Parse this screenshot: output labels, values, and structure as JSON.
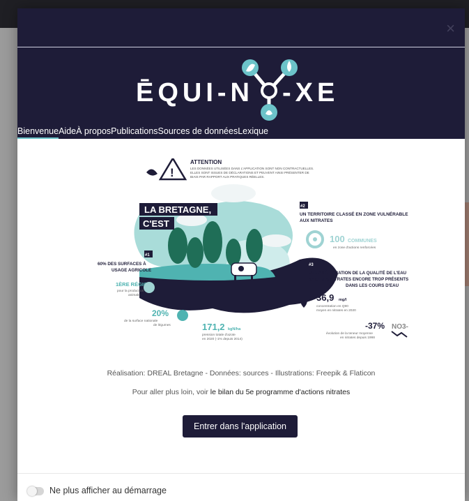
{
  "dialog": {
    "close_label": "×",
    "logo_left": "ĒQUI-N",
    "logo_right": "-XE",
    "tabs": [
      "Bienvenue",
      "Aide",
      "À propos",
      "Publications",
      "Sources de données",
      "Lexique"
    ]
  },
  "warning": {
    "title": "ATTENTION",
    "line1": "LES DONNÉES UTILISÉES DANS L'APPLICATION SONT NON CONTRACTUELLES.",
    "line2": "ELLES SONT ISSUES DE DÉCLARATIONS ET PEUVENT AINSI PRÉSENTER DE",
    "line3": "BIAIS PAR RAPPORT AUX PRATIQUES RÉELLES."
  },
  "infographic": {
    "title_line1": "LA BRETAGNE,",
    "title_line2": "C'EST",
    "fact2_num": "#2",
    "fact2_line1": "UN TERRITOIRE CLASSÉ EN ZONE VULNÉRABLE",
    "fact2_line2": "AUX NITRATES",
    "communes_value": "100",
    "communes_label": "COMMUNES",
    "communes_sub": "en zone d'actions renforcées",
    "fact1_num": "#1",
    "fact1_line1": "60% DES SURFACES À",
    "fact1_line2": "USAGE AGRICOLE",
    "region_rank": "1ÈRE RÉGION",
    "region_sub1": "pour la production",
    "region_sub2": "animale",
    "fact3_num": "#3",
    "fact3_line1": "UNE AMÉLIORATION DE LA QUALITÉ DE L'EAU",
    "fact3_line2": "MAIS DES NITRATES ENCORE TROP PRÉSENTS",
    "fact3_line3": "DANS LES COURS D'EAU",
    "nitrate_value": "36,9",
    "nitrate_unit": "mg/l",
    "nitrate_sub1": "concentration en Q90",
    "nitrate_sub2": "moyen en nitrates en 2020",
    "veg_value": "20%",
    "veg_sub1": "de la surface nationale",
    "veg_sub2": "de légumes",
    "azote_value": "171,2",
    "azote_unit": "kgN/ha",
    "azote_sub1": "pression totale d'azote",
    "azote_sub2": "en 2020 (-1% depuis 2014)",
    "trend_value": "-37%",
    "trend_sub1": "évolution de la teneur moyenne",
    "trend_sub2": "en nitrates depuis 1998",
    "no3_label": "NO3-"
  },
  "credits": "Réalisation: DREAL Bretagne - Données: sources - Illustrations: Freepik & Flaticon",
  "more_prefix": "Pour aller plus loin, voir ",
  "more_link": "le bilan du 5e programme d'actions nitrates",
  "enter_button": "Entrer dans l'application",
  "footer_label": "Ne plus afficher au démarrage",
  "colors": {
    "header_bg": "#1e1c38",
    "teal": "#4fb3b1",
    "light_teal": "#9fd3d3",
    "dark_green": "#1f6e57",
    "dark_soil": "#1e1c38"
  }
}
